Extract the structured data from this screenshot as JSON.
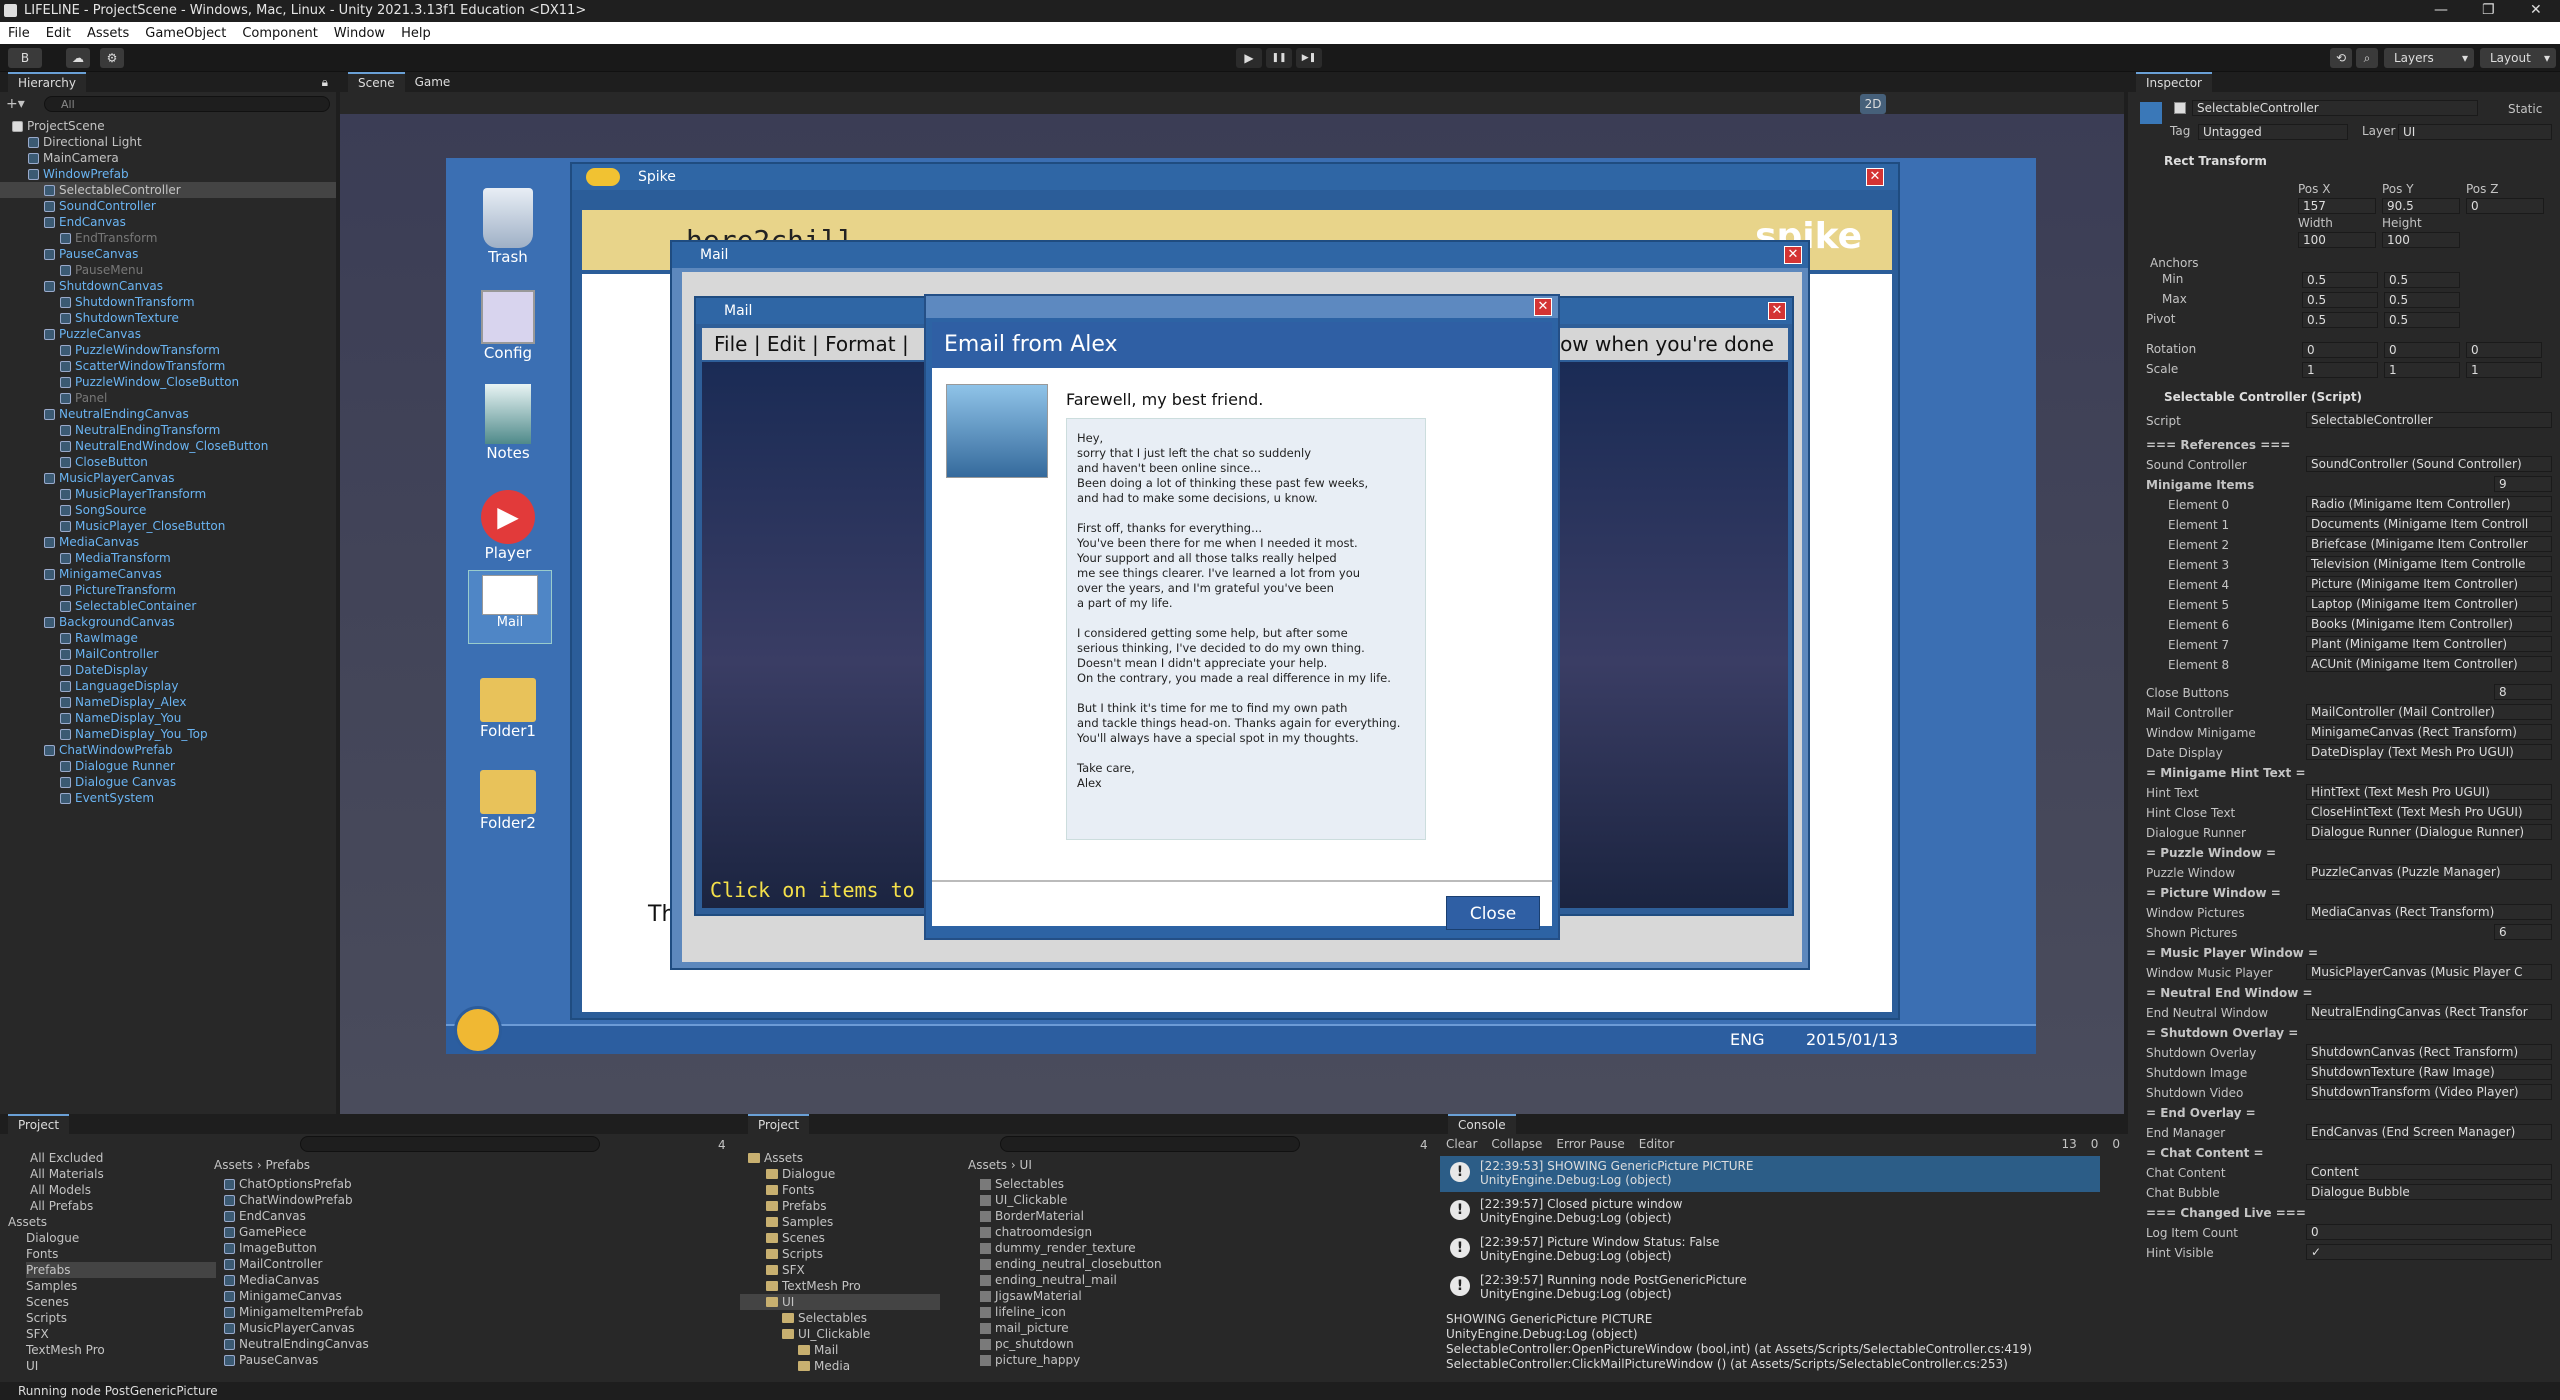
{
  "window": {
    "title": "LIFELINE - ProjectScene - Windows, Mac, Linux - Unity 2021.3.13f1 Education <DX11>",
    "min": "—",
    "max": "❐",
    "close": "✕"
  },
  "menu": [
    "File",
    "Edit",
    "Assets",
    "GameObject",
    "Component",
    "Window",
    "Help"
  ],
  "toolbar": {
    "account": "B",
    "layers": "Layers",
    "layout": "Layout",
    "play": "▶",
    "pause": "❚❚",
    "step": "▶❚"
  },
  "hierarchy": {
    "tab": "Hierarchy",
    "search_placeholder": "All",
    "items": [
      {
        "label": "ProjectScene",
        "indent": 0,
        "kind": "scene"
      },
      {
        "label": "Directional Light",
        "indent": 1
      },
      {
        "label": "MainCamera",
        "indent": 1
      },
      {
        "label": "WindowPrefab",
        "indent": 1,
        "blue": true
      },
      {
        "label": "SelectableController",
        "indent": 2,
        "sel": true
      },
      {
        "label": "SoundController",
        "indent": 2,
        "blue": true
      },
      {
        "label": "EndCanvas",
        "indent": 2,
        "blue": true
      },
      {
        "label": "EndTransform",
        "indent": 3,
        "gray": true
      },
      {
        "label": "PauseCanvas",
        "indent": 2,
        "blue": true
      },
      {
        "label": "PauseMenu",
        "indent": 3,
        "gray": true
      },
      {
        "label": "ShutdownCanvas",
        "indent": 2,
        "blue": true
      },
      {
        "label": "ShutdownTransform",
        "indent": 3,
        "blue": true
      },
      {
        "label": "ShutdownTexture",
        "indent": 3,
        "blue": true
      },
      {
        "label": "PuzzleCanvas",
        "indent": 2,
        "blue": true
      },
      {
        "label": "PuzzleWindowTransform",
        "indent": 3,
        "blue": true
      },
      {
        "label": "ScatterWindowTransform",
        "indent": 3,
        "blue": true
      },
      {
        "label": "PuzzleWindow_CloseButton",
        "indent": 3,
        "blue": true
      },
      {
        "label": "Panel",
        "indent": 3,
        "gray": true
      },
      {
        "label": "NeutralEndingCanvas",
        "indent": 2,
        "blue": true
      },
      {
        "label": "NeutralEndingTransform",
        "indent": 3,
        "blue": true
      },
      {
        "label": "NeutralEndWindow_CloseButton",
        "indent": 3,
        "blue": true
      },
      {
        "label": "CloseButton",
        "indent": 3,
        "blue": true
      },
      {
        "label": "MusicPlayerCanvas",
        "indent": 2,
        "blue": true
      },
      {
        "label": "MusicPlayerTransform",
        "indent": 3,
        "blue": true
      },
      {
        "label": "SongSource",
        "indent": 3,
        "blue": true
      },
      {
        "label": "MusicPlayer_CloseButton",
        "indent": 3,
        "blue": true
      },
      {
        "label": "MediaCanvas",
        "indent": 2,
        "blue": true
      },
      {
        "label": "MediaTransform",
        "indent": 3,
        "blue": true
      },
      {
        "label": "MinigameCanvas",
        "indent": 2,
        "blue": true
      },
      {
        "label": "PictureTransform",
        "indent": 3,
        "blue": true
      },
      {
        "label": "SelectableContainer",
        "indent": 3,
        "blue": true
      },
      {
        "label": "BackgroundCanvas",
        "indent": 2,
        "blue": true
      },
      {
        "label": "RawImage",
        "indent": 3,
        "blue": true
      },
      {
        "label": "MailController",
        "indent": 3,
        "blue": true
      },
      {
        "label": "DateDisplay",
        "indent": 3,
        "blue": true
      },
      {
        "label": "LanguageDisplay",
        "indent": 3,
        "blue": true
      },
      {
        "label": "NameDisplay_Alex",
        "indent": 3,
        "blue": true
      },
      {
        "label": "NameDisplay_You",
        "indent": 3,
        "blue": true
      },
      {
        "label": "NameDisplay_You_Top",
        "indent": 3,
        "blue": true
      },
      {
        "label": "ChatWindowPrefab",
        "indent": 2,
        "blue": true
      },
      {
        "label": "Dialogue Runner",
        "indent": 3,
        "blue": true
      },
      {
        "label": "Dialogue Canvas",
        "indent": 3,
        "blue": true
      },
      {
        "label": "EventSystem",
        "indent": 3,
        "blue": true
      }
    ]
  },
  "scene": {
    "tab_scene": "Scene",
    "tab_game": "Game",
    "mode_2d": "2D"
  },
  "game": {
    "desktop_icons": [
      "Trash",
      "Config",
      "Notes",
      "Player",
      "Mail",
      "Folder1",
      "Folder2"
    ],
    "chat_window_title": "Spike",
    "chat_header": "here2chill",
    "spike_logo": "spike",
    "mail_title": "Mail",
    "mail_menu": "File | Edit | Format |",
    "mail_menu_right": "ow when you're done",
    "hill": "hill",
    "click_hint": "Click on items to talk",
    "th": "Th",
    "email": {
      "title": "Email from Alex",
      "subject": "Farewell, my best friend.",
      "close": "Close",
      "body": "Hey,\nsorry that I just left the chat so suddenly\nand haven't been online since...\nBeen doing a lot of thinking these past few weeks,\nand had to make some decisions, u know.\n\nFirst off, thanks for everything...\nYou've been there for me when I needed it most.\nYour support and all those talks really helped\nme see things clearer. I've learned a lot from you\nover the years, and I'm grateful you've been\na part of my life.\n\nI considered getting some help, but after some\nserious thinking, I've decided to do my own thing.\nDoesn't mean I didn't appreciate your help.\nOn the contrary, you made a real difference in my life.\n\nBut I think it's time for me to find my own path\nand tackle things head-on. Thanks again for everything.\nYou'll always have a special spot in my thoughts.\n\nTake care,\nAlex"
    },
    "taskbar": {
      "lang": "ENG",
      "date": "2015/01/13"
    }
  },
  "inspector": {
    "tab": "Inspector",
    "object_name": "SelectableController",
    "static": "Static",
    "tag_label": "Tag",
    "tag": "Untagged",
    "layer_label": "Layer",
    "layer": "UI",
    "rect_transform": "Rect Transform",
    "pos_x_label": "Pos X",
    "pos_y_label": "Pos Y",
    "pos_z_label": "Pos Z",
    "pos_x": "157",
    "pos_y": "90.5",
    "pos_z": "0",
    "width_label": "Width",
    "height_label": "Height",
    "width": "100",
    "height": "100",
    "anchors": "Anchors",
    "min": "Min",
    "max": "Max",
    "pivot": "Pivot",
    "rotation": "Rotation",
    "scale": "Scale",
    "anchor_min_x": "0.5",
    "anchor_min_y": "0.5",
    "anchor_max_x": "0.5",
    "anchor_max_y": "0.5",
    "pivot_x": "0.5",
    "pivot_y": "0.5",
    "rot_x": "0",
    "rot_y": "0",
    "rot_z": "0",
    "scale_x": "1",
    "scale_y": "1",
    "scale_z": "1",
    "script_component": "Selectable Controller (Script)",
    "script_label": "Script",
    "script_value": "SelectableController",
    "references": "=== References ===",
    "sound_controller_label": "Sound Controller",
    "sound_controller": "SoundController (Sound Controller)",
    "minigame_items": "Minigame Items",
    "minigame_count": "9",
    "elements": [
      {
        "label": "Element 0",
        "value": "Radio (Minigame Item Controller)"
      },
      {
        "label": "Element 1",
        "value": "Documents (Minigame Item Controll"
      },
      {
        "label": "Element 2",
        "value": "Briefcase (Minigame Item Controller"
      },
      {
        "label": "Element 3",
        "value": "Television (Minigame Item Controlle"
      },
      {
        "label": "Element 4",
        "value": "Picture (Minigame Item Controller)"
      },
      {
        "label": "Element 5",
        "value": "Laptop (Minigame Item Controller)"
      },
      {
        "label": "Element 6",
        "value": "Books (Minigame Item Controller)"
      },
      {
        "label": "Element 7",
        "value": "Plant (Minigame Item Controller)"
      },
      {
        "label": "Element 8",
        "value": "ACUnit (Minigame Item Controller)"
      }
    ],
    "fields": [
      {
        "label": "Close Buttons",
        "value": "8",
        "kind": "count"
      },
      {
        "label": "Mail Controller",
        "value": "MailController (Mail Controller)"
      },
      {
        "label": "Window Minigame",
        "value": "MinigameCanvas (Rect Transform)"
      },
      {
        "label": "Date Display",
        "value": "DateDisplay (Text Mesh Pro UGUI)"
      },
      {
        "label": "= Minigame Hint Text =",
        "kind": "header"
      },
      {
        "label": "Hint Text",
        "value": "HintText (Text Mesh Pro UGUI)"
      },
      {
        "label": "Hint Close Text",
        "value": "CloseHintText (Text Mesh Pro UGUI)"
      },
      {
        "label": "Dialogue Runner",
        "value": "Dialogue Runner (Dialogue Runner)"
      },
      {
        "label": "= Puzzle Window =",
        "kind": "header"
      },
      {
        "label": "Puzzle Window",
        "value": "PuzzleCanvas (Puzzle Manager)"
      },
      {
        "label": "= Picture Window =",
        "kind": "header"
      },
      {
        "label": "Window Pictures",
        "value": "MediaCanvas (Rect Transform)"
      },
      {
        "label": "Shown Pictures",
        "value": "6",
        "kind": "count"
      },
      {
        "label": "= Music Player Window =",
        "kind": "header"
      },
      {
        "label": "Window Music Player",
        "value": "MusicPlayerCanvas (Music Player C"
      },
      {
        "label": "= Neutral End Window =",
        "kind": "header"
      },
      {
        "label": "End Neutral Window",
        "value": "NeutralEndingCanvas (Rect Transfor"
      },
      {
        "label": "= Shutdown Overlay =",
        "kind": "header"
      },
      {
        "label": "Shutdown Overlay",
        "value": "ShutdownCanvas (Rect Transform)"
      },
      {
        "label": "Shutdown Image",
        "value": "ShutdownTexture (Raw Image)"
      },
      {
        "label": "Shutdown Video",
        "value": "ShutdownTransform (Video Player)"
      },
      {
        "label": "= End Overlay =",
        "kind": "header"
      },
      {
        "label": "End Manager",
        "value": "EndCanvas (End Screen Manager)"
      },
      {
        "label": "= Chat Content =",
        "kind": "header"
      },
      {
        "label": "Chat Content",
        "value": "Content"
      },
      {
        "label": "Chat Bubble",
        "value": "Dialogue Bubble"
      },
      {
        "label": "=== Changed Live ===",
        "kind": "header"
      },
      {
        "label": "Log Item Count",
        "value": "0"
      },
      {
        "label": "Hint Visible",
        "value": "✓"
      }
    ]
  },
  "project1": {
    "tab": "Project",
    "sidebar": [
      "All Excluded",
      "All Materials",
      "All Models",
      "All Prefabs",
      "Assets",
      "Dialogue",
      "Fonts",
      "Prefabs",
      "Samples",
      "Scenes",
      "Scripts",
      "SFX",
      "TextMesh Pro",
      "UI"
    ],
    "breadcrumb_root": "Assets",
    "breadcrumb_sep": "›",
    "breadcrumb": "Prefabs",
    "count": "4",
    "files": [
      "ChatOptionsPrefab",
      "ChatWindowPrefab",
      "EndCanvas",
      "GamePiece",
      "ImageButton",
      "MailController",
      "MediaCanvas",
      "MinigameCanvas",
      "MinigameItemPrefab",
      "MusicPlayerCanvas",
      "NeutralEndingCanvas",
      "PauseCanvas"
    ]
  },
  "project2": {
    "tab": "Project",
    "tree": [
      "Assets",
      "Dialogue",
      "Fonts",
      "Prefabs",
      "Samples",
      "Scenes",
      "Scripts",
      "SFX",
      "TextMesh Pro",
      "UI",
      "Selectables",
      "UI_Clickable",
      "Mail",
      "Media"
    ],
    "breadcrumb_root": "Assets",
    "breadcrumb_sep": "›",
    "breadcrumb": "UI",
    "count": "4",
    "files": [
      "Selectables",
      "UI_Clickable",
      "BorderMaterial",
      "chatroomdesign",
      "dummy_render_texture",
      "ending_neutral_closebutton",
      "ending_neutral_mail",
      "JigsawMaterial",
      "lifeline_icon",
      "mail_picture",
      "pc_shutdown",
      "picture_happy"
    ]
  },
  "console": {
    "tab": "Console",
    "clear": "Clear",
    "collapse": "Collapse",
    "error_pause": "Error Pause",
    "editor": "Editor",
    "count_warn": "13",
    "count_err": "0",
    "count_msg": "0",
    "entries": [
      {
        "line1": "[22:39:53] SHOWING GenericPicture PICTURE",
        "line2": "UnityEngine.Debug:Log (object)",
        "sel": true
      },
      {
        "line1": "[22:39:57] Closed picture window",
        "line2": "UnityEngine.Debug:Log (object)"
      },
      {
        "line1": "[22:39:57] Picture Window Status: False",
        "line2": "UnityEngine.Debug:Log (object)"
      },
      {
        "line1": "[22:39:57] Running node PostGenericPicture",
        "line2": "UnityEngine.Debug:Log (object)"
      }
    ],
    "detail": [
      "SHOWING GenericPicture PICTURE",
      "UnityEngine.Debug:Log (object)",
      "SelectableController:OpenPictureWindow (bool,int) (at Assets/Scripts/SelectableController.cs:419)",
      "SelectableController:ClickMailPictureWindow () (at Assets/Scripts/SelectableController.cs:253)"
    ]
  },
  "status": {
    "text": "Running node PostGenericPicture"
  }
}
